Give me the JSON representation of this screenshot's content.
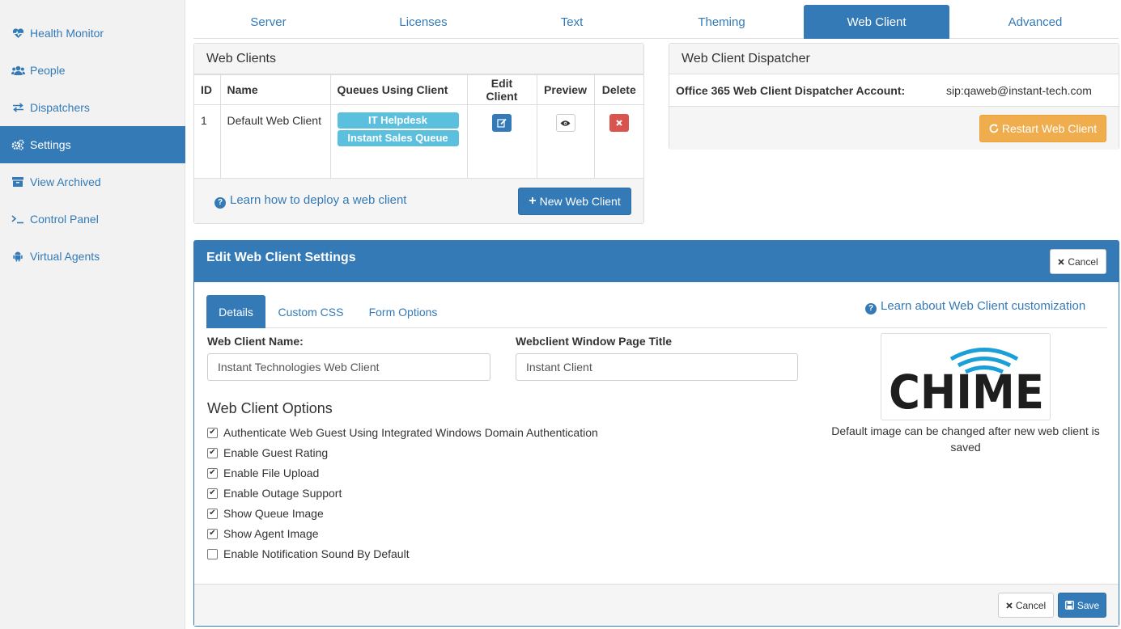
{
  "sidebar": {
    "items": [
      {
        "label": "Health Monitor",
        "icon": "heartbeat-icon"
      },
      {
        "label": "People",
        "icon": "users-icon"
      },
      {
        "label": "Dispatchers",
        "icon": "exchange-icon"
      },
      {
        "label": "Settings",
        "icon": "gears-icon",
        "active": true
      },
      {
        "label": "View Archived",
        "icon": "archive-icon"
      },
      {
        "label": "Control Panel",
        "icon": "terminal-icon"
      },
      {
        "label": "Virtual Agents",
        "icon": "android-icon"
      }
    ]
  },
  "tabs": [
    "Server",
    "Licenses",
    "Text",
    "Theming",
    "Web Client",
    "Advanced"
  ],
  "active_tab": "Web Client",
  "web_clients": {
    "title": "Web Clients",
    "columns": [
      "ID",
      "Name",
      "Queues Using Client",
      "Edit Client",
      "Preview",
      "Delete"
    ],
    "rows": [
      {
        "id": "1",
        "name": "Default Web Client",
        "queues": [
          "IT Helpdesk",
          "Instant Sales Queue"
        ]
      }
    ],
    "learn_link": "Learn how to deploy a web client",
    "new_button": "New Web Client"
  },
  "dispatcher": {
    "title": "Web Client Dispatcher",
    "account_label": "Office 365 Web Client Dispatcher Account:",
    "account_value": "sip:qaweb@instant-tech.com",
    "restart_button": "Restart Web Client"
  },
  "edit": {
    "title": "Edit Web Client Settings",
    "cancel_label": "Cancel",
    "save_label": "Save",
    "subtabs": [
      "Details",
      "Custom CSS",
      "Form Options"
    ],
    "active_subtab": "Details",
    "learn_link": "Learn about Web Client customization",
    "name_label": "Web Client Name:",
    "name_value": "Instant Technologies Web Client",
    "title_label": "Webclient Window Page Title",
    "title_value": "Instant Client",
    "options_heading": "Web Client Options",
    "options": [
      {
        "label": "Authenticate Web Guest Using Integrated Windows Domain Authentication",
        "checked": true
      },
      {
        "label": "Enable Guest Rating",
        "checked": true
      },
      {
        "label": "Enable File Upload",
        "checked": true
      },
      {
        "label": "Enable Outage Support",
        "checked": true
      },
      {
        "label": "Show Queue Image",
        "checked": true
      },
      {
        "label": "Show Agent Image",
        "checked": true
      },
      {
        "label": "Enable Notification Sound By Default",
        "checked": false
      }
    ],
    "logo_text": "CHIME",
    "image_note": "Default image can be changed after new web client is saved"
  },
  "colors": {
    "primary": "#337ab7",
    "info": "#5bc0de",
    "warning": "#f0ad4e",
    "danger": "#d9534f"
  }
}
